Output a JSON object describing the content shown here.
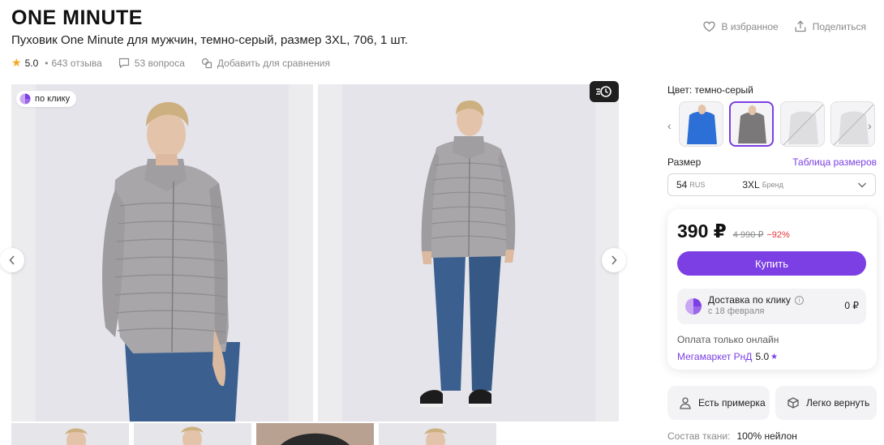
{
  "brand": "ONE MINUTE",
  "product_title": "Пуховик One Minute для мужчин, темно-серый, размер 3XL, 706, 1 шт.",
  "rating": "5.0",
  "rating_separator": "•",
  "reviews": "643 отзыва",
  "questions": "53 вопроса",
  "compare": "Добавить для сравнения",
  "top_actions": {
    "favorite": "В избранное",
    "share": "Поделиться"
  },
  "gallery": {
    "badge_label": "по клику",
    "icons": {
      "prev": "chevron-left-icon",
      "next": "chevron-right-icon",
      "fast": "fast-delivery-icon"
    }
  },
  "color": {
    "label": "Цвет: темно-серый",
    "options": [
      "blue",
      "dark-gray",
      "gray-unavailable",
      "gray-unavailable"
    ]
  },
  "size": {
    "label": "Размер",
    "table_link": "Таблица размеров",
    "value_ru": "54",
    "unit_ru": "RUS",
    "value_brand": "3XL",
    "unit_brand": "Бренд"
  },
  "price": {
    "current": "390 ₽",
    "old": "4 990 ₽",
    "discount": "−92%",
    "buy_label": "Купить"
  },
  "delivery": {
    "title": "Доставка по клику",
    "date": "с 18 февраля",
    "cost": "0 ₽"
  },
  "payment_note": "Оплата только онлайн",
  "seller": {
    "name": "Мегамаркет РнД",
    "rating": "5.0"
  },
  "services": {
    "fitting": "Есть примерка",
    "return": "Легко вернуть"
  },
  "composition": {
    "label": "Состав ткани:",
    "value": "100% нейлон"
  },
  "colors": {
    "accent": "#7b3fe4",
    "discount": "#e5333a",
    "star": "#f5a623",
    "jacket": "#a8a6a8",
    "jeans": "#3b5f8e"
  }
}
